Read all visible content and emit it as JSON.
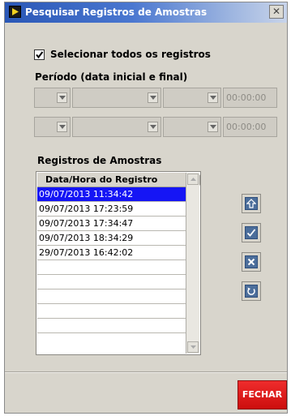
{
  "window": {
    "title": "Pesquisar Registros de Amostras",
    "close_glyph": "✕"
  },
  "select_all": {
    "label": "Selecionar todos os registros",
    "checked": true
  },
  "period": {
    "label": "Período (data inicial e final)",
    "start_time": "00:00:00",
    "end_time": "00:00:00"
  },
  "records": {
    "label": "Registros de Amostras",
    "column_header": "Data/Hora do Registro",
    "rows": [
      "09/07/2013 11:34:42",
      "09/07/2013 17:23:59",
      "09/07/2013 17:34:47",
      "09/07/2013 18:34:29",
      "29/07/2013 16:42:02",
      "",
      "",
      "",
      "",
      ""
    ],
    "selected_index": 0
  },
  "side_buttons": [
    "up-arrow-icon",
    "checkmark-icon",
    "x-icon",
    "refresh-icon"
  ],
  "footer": {
    "close_label": "FECHAR"
  },
  "colors": {
    "title_bar": "#2a57b6",
    "selection": "#1515f5",
    "close_button": "#e01a1a",
    "side_button": "#4c6e9b"
  }
}
